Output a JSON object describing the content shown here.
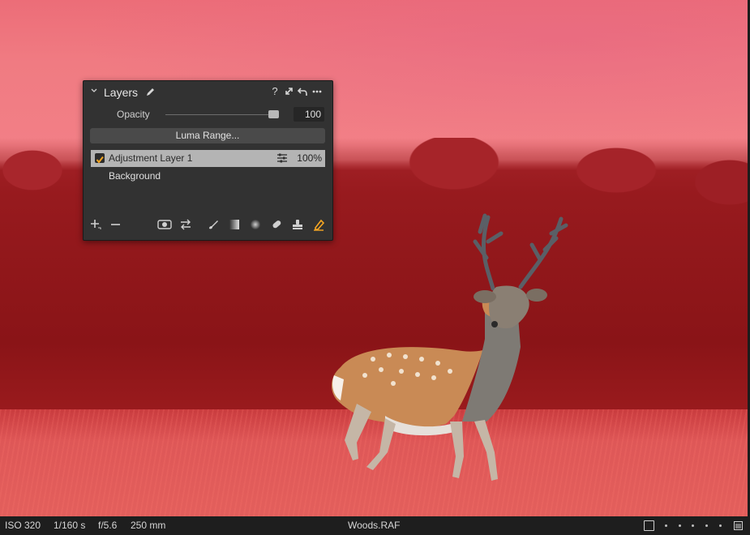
{
  "layers_panel": {
    "title": "Layers",
    "opacity_label": "Opacity",
    "opacity_value": "100",
    "opacity_level": 1.0,
    "luma_button": "Luma Range...",
    "layers": [
      {
        "name": "Adjustment Layer 1",
        "opacity": "100%",
        "checked": true,
        "selected": true
      },
      {
        "name": "Background"
      }
    ],
    "header_icons": [
      "pencil-icon",
      "help-icon",
      "expand-icon",
      "reset-icon",
      "more-icon"
    ],
    "toolbar_icons": [
      "add-icon",
      "remove-icon",
      "eye-icon",
      "swap-icon",
      "brush-icon",
      "gradient-icon",
      "radial-icon",
      "heal-icon",
      "clone-icon",
      "eraser-icon"
    ],
    "accent_color": "#f5a623"
  },
  "status": {
    "iso": "ISO 320",
    "shutter": "1/160 s",
    "aperture": "f/5.6",
    "focal": "250 mm",
    "filename": "Woods.RAF"
  }
}
